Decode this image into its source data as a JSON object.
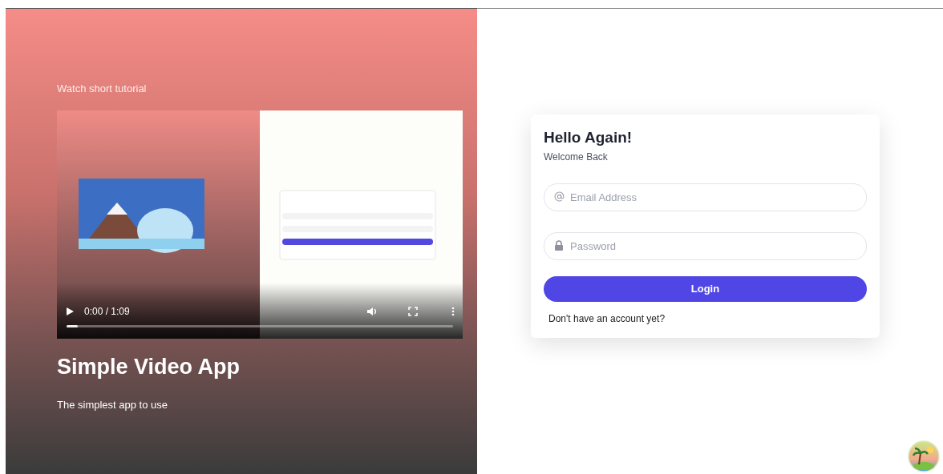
{
  "hero": {
    "caption": "Watch short tutorial",
    "video": {
      "kind": "picture",
      "playing": false,
      "time": "0:00 / 1:09",
      "progress": {
        "level": 0.03
      }
    },
    "title": "Simple Video App",
    "subtitle": "The simplest app to use"
  },
  "login": {
    "title": "Hello Again!",
    "subtitle": "Welcome Back",
    "fields": [
      {
        "kind": "email",
        "placeholder": "Email Address"
      },
      {
        "kind": "password",
        "placeholder": "Password"
      }
    ],
    "button": "Login",
    "signup_link": "Don't have an account yet?"
  }
}
